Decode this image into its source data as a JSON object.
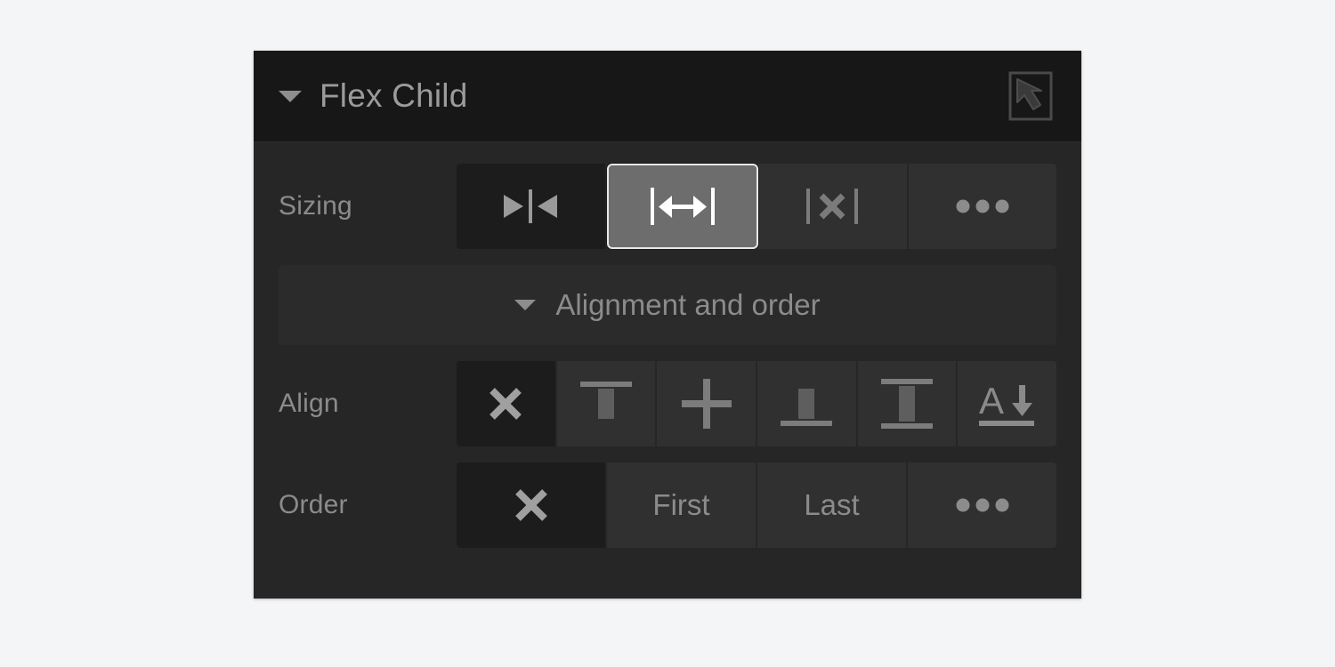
{
  "page": {
    "background_color": "#f4f5f7"
  },
  "panel": {
    "title": "Flex Child",
    "background_color": "#262626",
    "header_background_color": "#171717",
    "collapse_icon": "caret-down-icon",
    "parent_select_icon": "select-parent-arrow-icon",
    "rows": {
      "sizing": {
        "label": "Sizing",
        "options": [
          {
            "name": "shrink",
            "icon": "shrink-horizontal-icon",
            "state": "off",
            "label": ""
          },
          {
            "name": "grow",
            "icon": "grow-horizontal-icon",
            "state": "selected",
            "label": ""
          },
          {
            "name": "no-resize",
            "icon": "no-resize-icon",
            "state": "normal",
            "label": ""
          },
          {
            "name": "more",
            "icon": "ellipsis-icon",
            "state": "normal",
            "label": ""
          }
        ]
      },
      "alignment_and_order": {
        "label": "Alignment and order",
        "icon": "caret-down-icon",
        "expanded": true
      },
      "align": {
        "label": "Align",
        "options": [
          {
            "name": "none",
            "icon": "close-x-icon",
            "state": "off",
            "label": ""
          },
          {
            "name": "start",
            "icon": "align-start-icon",
            "state": "normal",
            "label": ""
          },
          {
            "name": "center",
            "icon": "align-center-icon",
            "state": "normal",
            "label": ""
          },
          {
            "name": "end",
            "icon": "align-end-icon",
            "state": "normal",
            "label": ""
          },
          {
            "name": "stretch",
            "icon": "align-stretch-icon",
            "state": "normal",
            "label": ""
          },
          {
            "name": "baseline",
            "icon": "align-baseline-icon",
            "state": "normal",
            "label": ""
          }
        ]
      },
      "order": {
        "label": "Order",
        "options": [
          {
            "name": "none",
            "icon": "close-x-icon",
            "state": "off",
            "label": ""
          },
          {
            "name": "first",
            "icon": "",
            "state": "normal",
            "label": "First"
          },
          {
            "name": "last",
            "icon": "",
            "state": "normal",
            "label": "Last"
          },
          {
            "name": "more",
            "icon": "ellipsis-icon",
            "state": "normal",
            "label": ""
          }
        ]
      }
    }
  },
  "colors": {
    "selected_button_bg": "#6d6d6d",
    "selected_button_border": "#e8e8e8",
    "button_bg": "#303030",
    "button_off_bg": "#1c1c1c",
    "label_text": "#8b8b8b",
    "title_text": "#9b9b9b",
    "icon_stroke": "#9a9a9a"
  }
}
